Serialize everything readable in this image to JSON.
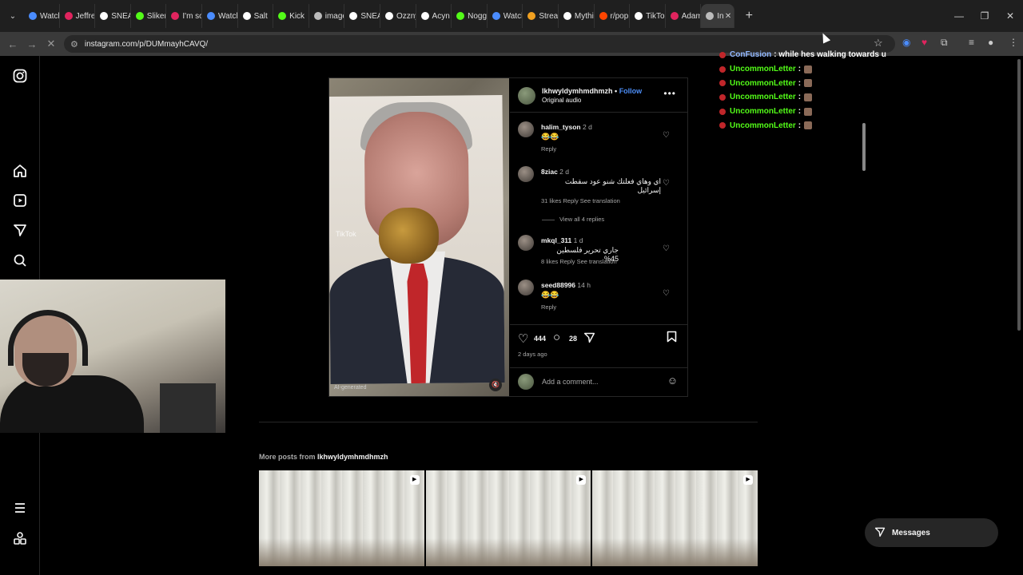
{
  "browser": {
    "tabs": [
      {
        "label": "Watch",
        "color": "#4a8cff"
      },
      {
        "label": "Jeffrey",
        "color": "#e0245e"
      },
      {
        "label": "SNEAK",
        "color": "#ffffff"
      },
      {
        "label": "Sliker",
        "color": "#53fc18"
      },
      {
        "label": "I'm so",
        "color": "#e0245e"
      },
      {
        "label": "Watch",
        "color": "#4a8cff"
      },
      {
        "label": "Salt",
        "color": "#ffffff"
      },
      {
        "label": "Kick",
        "color": "#53fc18"
      },
      {
        "label": "image",
        "color": "#bbbbbb"
      },
      {
        "label": "SNEAK",
        "color": "#ffffff"
      },
      {
        "label": "Ozzny",
        "color": "#ffffff"
      },
      {
        "label": "Acyn",
        "color": "#ffffff"
      },
      {
        "label": "Noggy",
        "color": "#53fc18"
      },
      {
        "label": "Watch",
        "color": "#4a8cff"
      },
      {
        "label": "Stream",
        "color": "#f0a020"
      },
      {
        "label": "Mythic",
        "color": "#ffffff"
      },
      {
        "label": "r/pop",
        "color": "#ff4500"
      },
      {
        "label": "TikTok",
        "color": "#ffffff"
      },
      {
        "label": "Adam",
        "color": "#e0245e"
      },
      {
        "label": "In",
        "color": "#bbbbbb",
        "active": true
      }
    ],
    "url": "instagram.com/p/DUMmayhCAVQ/"
  },
  "post": {
    "author": "lkhwyldymhmdhmzh",
    "follow_label": "Follow",
    "audio": "Original audio",
    "tiktok_watermark": "TikTok",
    "ai_label": "AI-generated",
    "comments": [
      {
        "user": "halim_tyson",
        "time": "2 d",
        "text": "😂😂",
        "meta": "Reply"
      },
      {
        "user": "8ziac",
        "time": "2 d",
        "text": "اي وهاي فعلتك شنو عود سقطت إسرائيل",
        "meta": "31 likes   Reply   See translation",
        "replies": "View all 4 replies"
      },
      {
        "user": "mkql_311",
        "time": "1 d",
        "text": "جاري تحرير فلسطين 45%",
        "meta": "8 likes   Reply   See translation"
      },
      {
        "user": "seed88996",
        "time": "14 h",
        "text": "😂😂",
        "meta": "Reply"
      }
    ],
    "likes": "444",
    "comment_count": "28",
    "posted": "2 days ago",
    "add_comment_placeholder": "Add a comment..."
  },
  "more_posts": {
    "label": "More posts from",
    "author": "lkhwyldymhmdhmzh"
  },
  "messages_label": "Messages",
  "chat_overlay": [
    {
      "user": "ConFusion",
      "message": ": while hes walking towards u",
      "style": "cf"
    },
    {
      "user": "UncommonLetter",
      "message": ":",
      "style": "green"
    },
    {
      "user": "UncommonLetter",
      "message": ":",
      "style": "green"
    },
    {
      "user": "UncommonLetter",
      "message": ":",
      "style": "green"
    },
    {
      "user": "UncommonLetter",
      "message": ":",
      "style": "green"
    },
    {
      "user": "UncommonLetter",
      "message": ":",
      "style": "green"
    }
  ]
}
